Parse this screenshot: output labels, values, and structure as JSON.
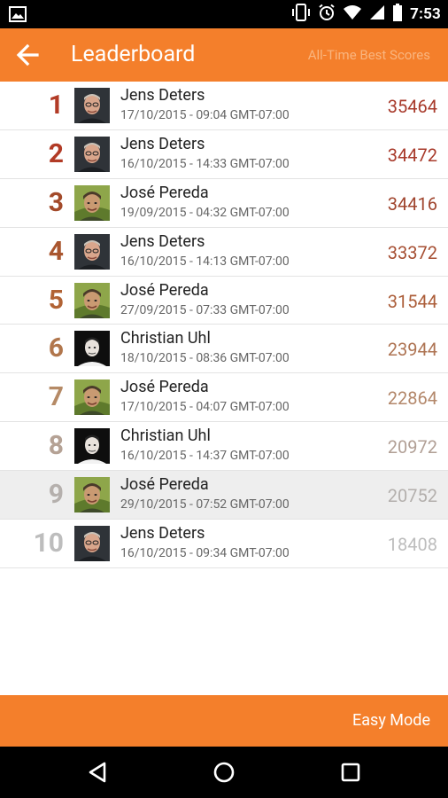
{
  "status_bar": {
    "time": "7:53",
    "left_icon": "image-icon",
    "icons": [
      "vibrate-icon",
      "alarm-icon",
      "wifi-icon",
      "signal-icon",
      "battery-icon"
    ]
  },
  "app_bar": {
    "back_icon": "arrow-back-icon",
    "title": "Leaderboard",
    "subtitle": "All-Time Best Scores"
  },
  "leaderboard": [
    {
      "rank": "1",
      "name": "Jens Deters",
      "date": "17/10/2015 - 09:04 GMT-07:00",
      "score": "35464",
      "rank_color": "#B23B26",
      "score_color": "#A83A2B",
      "avatar": "jens"
    },
    {
      "rank": "2",
      "name": "Jens Deters",
      "date": "16/10/2015 - 14:33 GMT-07:00",
      "score": "34472",
      "rank_color": "#B23B26",
      "score_color": "#A83A2B",
      "avatar": "jens"
    },
    {
      "rank": "3",
      "name": "José Pereda",
      "date": "19/09/2015 - 04:32 GMT-07:00",
      "score": "34416",
      "rank_color": "#A34A2A",
      "score_color": "#A0452E",
      "avatar": "jose"
    },
    {
      "rank": "4",
      "name": "Jens Deters",
      "date": "16/10/2015 - 14:13 GMT-07:00",
      "score": "33372",
      "rank_color": "#A9552E",
      "score_color": "#A64F33",
      "avatar": "jens"
    },
    {
      "rank": "5",
      "name": "José Pereda",
      "date": "27/09/2015 - 07:33 GMT-07:00",
      "score": "31544",
      "rank_color": "#B16335",
      "score_color": "#AC5E3A",
      "avatar": "jose"
    },
    {
      "rank": "6",
      "name": "Christian Uhl",
      "date": "18/10/2015 - 08:36 GMT-07:00",
      "score": "23944",
      "rank_color": "#B1764C",
      "score_color": "#AE7453",
      "avatar": "christian"
    },
    {
      "rank": "7",
      "name": "José Pereda",
      "date": "17/10/2015 - 04:07 GMT-07:00",
      "score": "22864",
      "rank_color": "#B58A66",
      "score_color": "#B3876A",
      "avatar": "jose"
    },
    {
      "rank": "8",
      "name": "Christian Uhl",
      "date": "16/10/2015 - 14:37 GMT-07:00",
      "score": "20972",
      "rank_color": "#B5A295",
      "score_color": "#B19F95",
      "avatar": "christian"
    },
    {
      "rank": "9",
      "name": "José Pereda",
      "date": "29/10/2015 - 07:52 GMT-07:00",
      "score": "20752",
      "rank_color": "#B5B0AD",
      "score_color": "#B3AFAC",
      "avatar": "jose",
      "selected": true
    },
    {
      "rank": "10",
      "name": "Jens Deters",
      "date": "16/10/2015 - 09:34 GMT-07:00",
      "score": "18408",
      "rank_color": "#BDBDBD",
      "score_color": "#BDBDBD",
      "avatar": "jens"
    }
  ],
  "bottom_bar": {
    "mode_label": "Easy Mode"
  },
  "nav_bar": {
    "icons": [
      "back-triangle-icon",
      "home-circle-icon",
      "recents-square-icon"
    ]
  },
  "colors": {
    "accent": "#F47F2B",
    "subtitle": "#F9B57F"
  }
}
